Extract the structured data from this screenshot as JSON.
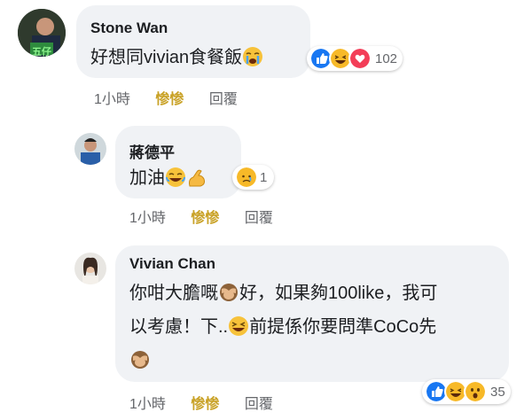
{
  "comments": [
    {
      "author": "Stone Wan",
      "text_before": "好想同vivian食餐飯",
      "time": "1小時",
      "laugh_label": "惨惨",
      "reply_label": "回覆",
      "reaction_count": "102",
      "avatar_tag": "五仔"
    },
    {
      "author": "蔣德平",
      "text_before": "加油",
      "time": "1小時",
      "laugh_label": "惨惨",
      "reply_label": "回覆",
      "reaction_count": "1"
    },
    {
      "author": "Vivian Chan",
      "line1_a": "你咁大膽嘅",
      "line1_b": "好，如果夠100like，我可",
      "line2_a": "以考慮！下..",
      "line2_b": "前提係你要問準CoCo先",
      "time": "1小時",
      "laugh_label": "惨惨",
      "reply_label": "回覆",
      "reaction_count": "35"
    }
  ],
  "colors": {
    "like_blue": "#1877f2",
    "love_red": "#f33e58",
    "haha_yellow": "#f7b928",
    "bubble_bg": "#f0f2f5",
    "meta_gray": "#65676b"
  }
}
